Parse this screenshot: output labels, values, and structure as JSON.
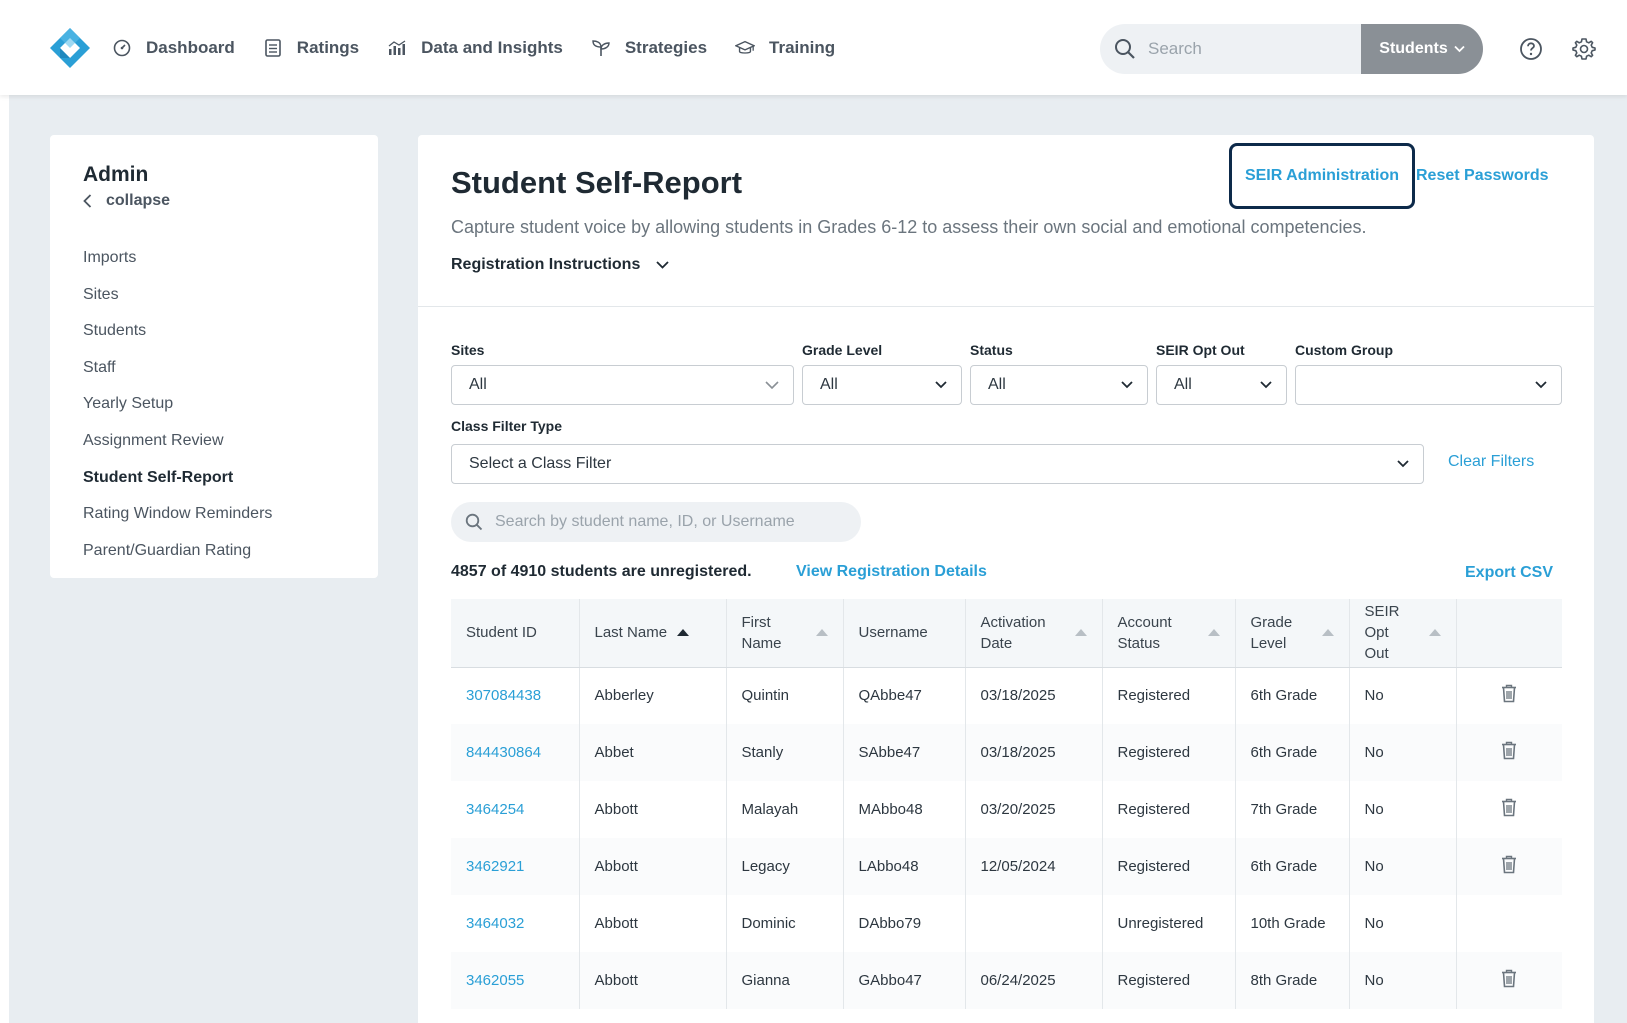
{
  "nav": {
    "items": [
      {
        "label": "Dashboard",
        "icon": "dashboard-gauge-icon"
      },
      {
        "label": "Ratings",
        "icon": "ratings-list-icon"
      },
      {
        "label": "Data and Insights",
        "icon": "chart-icon"
      },
      {
        "label": "Strategies",
        "icon": "sprout-icon"
      },
      {
        "label": "Training",
        "icon": "graduation-cap-icon"
      }
    ],
    "search_placeholder": "Search",
    "scope_label": "Students"
  },
  "sidebar": {
    "title": "Admin",
    "collapse_label": "collapse",
    "items": [
      {
        "label": "Imports"
      },
      {
        "label": "Sites"
      },
      {
        "label": "Students"
      },
      {
        "label": "Staff"
      },
      {
        "label": "Yearly Setup"
      },
      {
        "label": "Assignment Review"
      },
      {
        "label": "Student Self-Report",
        "active": true
      },
      {
        "label": "Rating Window Reminders"
      },
      {
        "label": "Parent/Guardian Rating"
      }
    ]
  },
  "main": {
    "title": "Student Self-Report",
    "seir_admin_label": "SEIR Administration",
    "reset_passwords_label": "Reset Passwords",
    "subtitle": "Capture student voice by allowing students in Grades 6-12 to assess their own social and emotional competencies.",
    "registration_instructions": "Registration Instructions"
  },
  "filters": {
    "sites": {
      "label": "Sites",
      "value": "All"
    },
    "grade_level": {
      "label": "Grade Level",
      "value": "All"
    },
    "status": {
      "label": "Status",
      "value": "All"
    },
    "seir_opt_out": {
      "label": "SEIR Opt Out",
      "value": "All"
    },
    "custom_group": {
      "label": "Custom Group",
      "value": ""
    },
    "class_filter_type": {
      "label": "Class Filter Type",
      "value": "Select a Class Filter"
    },
    "clear_label": "Clear Filters",
    "student_search_placeholder": "Search by student name, ID, or Username"
  },
  "summary": {
    "count_text": "4857 of 4910 students are unregistered.",
    "view_details_label": "View Registration Details",
    "export_label": "Export CSV"
  },
  "table": {
    "headers": [
      "Student ID",
      "Last Name",
      "First Name",
      "Username",
      "Activation Date",
      "Account Status",
      "Grade Level",
      "SEIR Opt Out"
    ],
    "rows": [
      {
        "id": "307084438",
        "last": "Abberley",
        "first": "Quintin",
        "username": "QAbbe47",
        "activation": "03/18/2025",
        "status": "Registered",
        "grade": "6th Grade",
        "opt_out": "No",
        "deletable": true
      },
      {
        "id": "844430864",
        "last": "Abbet",
        "first": "Stanly",
        "username": "SAbbe47",
        "activation": "03/18/2025",
        "status": "Registered",
        "grade": "6th Grade",
        "opt_out": "No",
        "deletable": true
      },
      {
        "id": "3464254",
        "last": "Abbott",
        "first": "Malayah",
        "username": "MAbbo48",
        "activation": "03/20/2025",
        "status": "Registered",
        "grade": "7th Grade",
        "opt_out": "No",
        "deletable": true
      },
      {
        "id": "3462921",
        "last": "Abbott",
        "first": "Legacy",
        "username": "LAbbo48",
        "activation": "12/05/2024",
        "status": "Registered",
        "grade": "6th Grade",
        "opt_out": "No",
        "deletable": true
      },
      {
        "id": "3464032",
        "last": "Abbott",
        "first": "Dominic",
        "username": "DAbbo79",
        "activation": "",
        "status": "Unregistered",
        "grade": "10th Grade",
        "opt_out": "No",
        "deletable": false
      },
      {
        "id": "3462055",
        "last": "Abbott",
        "first": "Gianna",
        "username": "GAbbo47",
        "activation": "06/24/2025",
        "status": "Registered",
        "grade": "8th Grade",
        "opt_out": "No",
        "deletable": true
      }
    ]
  },
  "colors": {
    "accent": "#2a9fd6",
    "highlight_border": "#0d2a4a",
    "scope_button": "#8a9096",
    "page_bg": "#e8edf1"
  }
}
